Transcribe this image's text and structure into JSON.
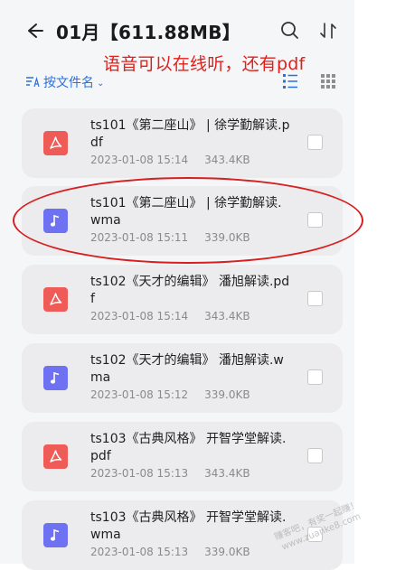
{
  "header": {
    "title": "01月【611.88MB】",
    "back_icon": "arrow-left-icon",
    "search_icon": "search-icon",
    "sort_icon": "sort-icon"
  },
  "annotation": "语音可以在线听，还有pdf",
  "sortbar": {
    "label": "按文件名",
    "chevron": "⌄",
    "list_icon": "list-view-icon",
    "grid_icon": "grid-view-icon"
  },
  "files": [
    {
      "name": "ts101《第二座山》 | 徐学勤解读.pdf",
      "date": "2023-01-08 15:14",
      "size": "343.4KB",
      "type": "pdf"
    },
    {
      "name": "ts101《第二座山》 | 徐学勤解读.wma",
      "date": "2023-01-08 15:11",
      "size": "339.0KB",
      "type": "audio"
    },
    {
      "name": "ts102《天才的编辑》 潘旭解读.pdf",
      "date": "2023-01-08 15:14",
      "size": "343.4KB",
      "type": "pdf"
    },
    {
      "name": "ts102《天才的编辑》 潘旭解读.wma",
      "date": "2023-01-08 15:12",
      "size": "339.0KB",
      "type": "audio"
    },
    {
      "name": "ts103《古典风格》 开智学堂解读.pdf",
      "date": "2023-01-08 15:13",
      "size": "343.4KB",
      "type": "pdf"
    },
    {
      "name": "ts103《古典风格》 开智学堂解读.wma",
      "date": "2023-01-08 15:13",
      "size": "339.0KB",
      "type": "audio"
    }
  ],
  "watermark": {
    "line1": "赚客吧，有奖一起赚！",
    "line2": "www.zuanke8.com"
  },
  "colors": {
    "accent": "#2a6fdb",
    "annotation": "#e0201b",
    "pdf_icon": "#ef5b57",
    "audio_icon": "#6e72f2"
  }
}
